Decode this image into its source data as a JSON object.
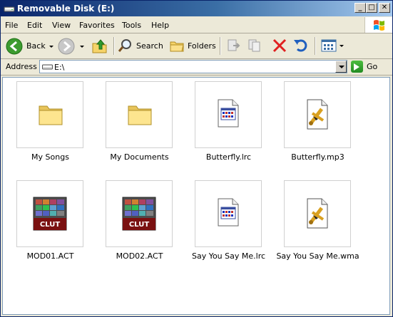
{
  "window": {
    "title": "Removable Disk (E:)",
    "buttons": {
      "minimize": "_",
      "maximize": "□",
      "close": "✕"
    }
  },
  "menu": [
    {
      "label": "File"
    },
    {
      "label": "Edit"
    },
    {
      "label": "View"
    },
    {
      "label": "Favorites"
    },
    {
      "label": "Tools"
    },
    {
      "label": "Help"
    }
  ],
  "toolbar": {
    "back": "Back",
    "search": "Search",
    "folders": "Folders"
  },
  "address": {
    "label": "Address",
    "value": "E:\\",
    "go": "Go"
  },
  "files": [
    {
      "name": "My Songs",
      "type": "folder"
    },
    {
      "name": "My Documents",
      "type": "folder"
    },
    {
      "name": "Butterfly.lrc",
      "type": "lrc"
    },
    {
      "name": "Butterfly.mp3",
      "type": "media"
    },
    {
      "name": "MOD01.ACT",
      "type": "clut"
    },
    {
      "name": "MOD02.ACT",
      "type": "clut"
    },
    {
      "name": "Say You Say Me.lrc",
      "type": "lrc"
    },
    {
      "name": "Say You Say Me.wma",
      "type": "media"
    }
  ],
  "clut_label": "CLUT",
  "colors": {
    "title_start": "#0a246a",
    "title_end": "#a6caf0",
    "chrome": "#ece9d8"
  }
}
